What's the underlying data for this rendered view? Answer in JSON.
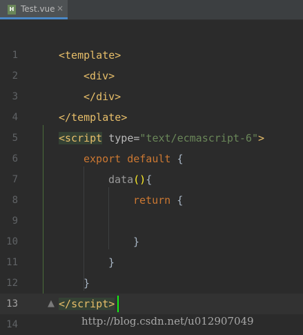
{
  "tab": {
    "label": "Test.vue",
    "close": "×",
    "icon_letter": "H",
    "icon": "vue-file-icon"
  },
  "gutter": [
    "1",
    "2",
    "3",
    "4",
    "5",
    "6",
    "7",
    "8",
    "9",
    "10",
    "11",
    "12",
    "13",
    "14"
  ],
  "code": {
    "l1": {
      "open": "<",
      "name": "template",
      "close": ">"
    },
    "l2": {
      "open": "<",
      "name": "div",
      "close": ">"
    },
    "l3": {
      "open": "</",
      "name": "div",
      "close": ">"
    },
    "l4": {
      "open": "</",
      "name": "template",
      "close": ">"
    },
    "l5": {
      "open": "<",
      "name": "script",
      "attr": " type=",
      "value": "\"text/ecmascript-6\"",
      "close": ">"
    },
    "l6": {
      "kw1": "export",
      "kw2": " default",
      "brace": " {"
    },
    "l7": {
      "fn": "data",
      "parens": "()",
      "brace": "{"
    },
    "l8": {
      "kw": "return",
      "brace": " {"
    },
    "l10": {
      "brace": "}"
    },
    "l11": {
      "brace": "}"
    },
    "l12": {
      "brace": "}"
    },
    "l13": {
      "open": "</",
      "name": "script",
      "close": ">"
    }
  },
  "watermark": "http://blog.csdn.net/u012907049",
  "colors": {
    "background": "#2b2b2b",
    "tag": "#e8bf6a",
    "keyword": "#cc7832",
    "string": "#6a8759",
    "caret": "#13f013"
  }
}
